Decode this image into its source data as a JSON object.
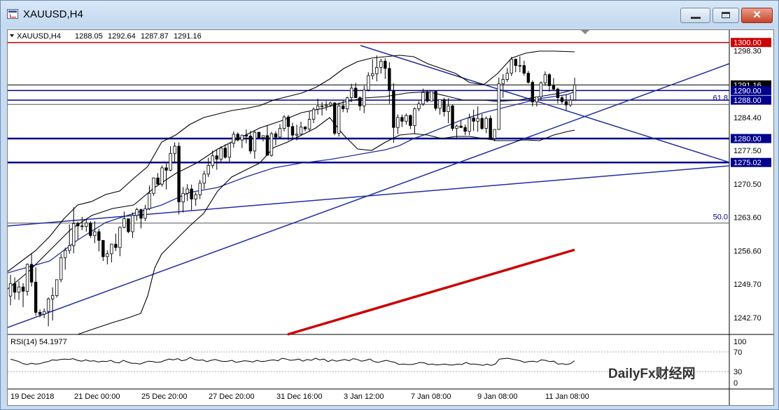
{
  "window": {
    "title": "XAUUSD,H4"
  },
  "legend": {
    "symbol": "XAUUSD,H4",
    "open": "1288.05",
    "high": "1292.64",
    "low": "1287.87",
    "close": "1291.16"
  },
  "price_axis": {
    "ticks": [
      "1298.30",
      "1284.40",
      "1277.50",
      "1270.50",
      "1263.60",
      "1256.60",
      "1249.70",
      "1242.70"
    ],
    "range": [
      1239.5,
      1302.0
    ]
  },
  "price_labels": [
    {
      "value": 1300.0,
      "text": "1300.00",
      "bg": "#cc0000"
    },
    {
      "value": 1291.16,
      "text": "1291.16",
      "bg": "#000000"
    },
    {
      "value": 1290.0,
      "text": "1290.00",
      "bg": "#00008b"
    },
    {
      "value": 1288.0,
      "text": "1288.00",
      "bg": "#00008b"
    },
    {
      "value": 1280.0,
      "text": "1280.00",
      "bg": "#00008b"
    },
    {
      "value": 1275.02,
      "text": "1275.02",
      "bg": "#00008b"
    }
  ],
  "fib_labels": [
    {
      "value": 1287.8,
      "text": "61.8"
    },
    {
      "value": 1263.0,
      "text": "50.0"
    }
  ],
  "time_axis": [
    "19 Dec 2018",
    "21 Dec 00:00",
    "25 Dec 20:00",
    "27 Dec 20:00",
    "31 Dec 16:00",
    "3 Jan 12:00",
    "7 Jan 08:00",
    "9 Jan 08:00",
    "11 Jan 08:00"
  ],
  "rsi": {
    "label": "RSI(14) 54.1977",
    "levels": [
      "100",
      "70",
      "30",
      "0"
    ],
    "values": [
      58,
      55,
      52,
      47,
      45,
      48,
      46,
      47,
      50,
      52,
      56,
      55,
      57,
      58,
      57,
      59,
      55,
      53,
      56,
      53,
      54,
      51,
      53,
      52,
      55,
      50,
      49,
      55,
      51,
      48,
      48,
      46,
      50,
      53,
      52,
      50,
      51,
      55,
      58,
      56,
      59,
      54,
      56,
      62,
      57,
      55,
      56,
      52,
      55,
      57,
      54,
      52,
      53,
      55,
      50,
      52,
      54,
      53,
      51,
      55,
      52,
      53,
      55,
      56,
      54,
      60,
      58,
      55,
      56,
      58,
      53,
      57,
      55,
      60,
      56,
      58,
      52,
      56,
      53,
      55,
      57,
      54,
      59,
      57,
      53,
      55,
      58,
      52,
      50,
      53,
      55,
      52,
      50,
      45,
      46,
      45,
      45,
      47,
      50,
      49,
      45,
      46,
      44,
      45,
      46,
      44,
      44,
      46,
      45,
      50,
      46,
      46,
      45,
      43,
      46,
      43,
      46,
      58,
      59,
      60,
      58,
      56,
      54,
      50,
      52,
      53,
      51,
      56,
      55,
      52,
      53,
      46,
      47,
      45,
      47,
      54
    ]
  },
  "colors": {
    "resistance": "#cc0000",
    "support": "#00008b",
    "trend": "#1f2fa0",
    "ma200": "#cc0000",
    "candle": "#000000"
  },
  "watermark": "DailyFx财经网",
  "candles": [
    [
      1247.2,
      1251.6,
      1245.3,
      1249.8
    ],
    [
      1249.8,
      1251.1,
      1246.5,
      1248.0
    ],
    [
      1248.0,
      1250.3,
      1246.4,
      1249.1
    ],
    [
      1249.1,
      1249.9,
      1244.9,
      1248.2
    ],
    [
      1248.2,
      1254.0,
      1247.3,
      1253.8
    ],
    [
      1253.8,
      1256.0,
      1249.2,
      1250.1
    ],
    [
      1250.1,
      1253.2,
      1243.1,
      1243.8
    ],
    [
      1243.8,
      1244.4,
      1242.8,
      1243.4
    ],
    [
      1243.4,
      1244.6,
      1242.6,
      1244.0
    ],
    [
      1244.0,
      1246.9,
      1240.9,
      1246.6
    ],
    [
      1246.6,
      1249.0,
      1242.1,
      1247.3
    ],
    [
      1247.3,
      1250.6,
      1246.9,
      1250.6
    ],
    [
      1250.6,
      1256.0,
      1250.1,
      1255.2
    ],
    [
      1255.2,
      1257.3,
      1252.7,
      1256.7
    ],
    [
      1256.7,
      1262.1,
      1256.0,
      1257.7
    ],
    [
      1257.7,
      1265.7,
      1256.1,
      1262.3
    ],
    [
      1262.3,
      1262.7,
      1259.0,
      1261.8
    ],
    [
      1261.8,
      1263.7,
      1260.9,
      1261.7
    ],
    [
      1261.7,
      1263.2,
      1260.6,
      1262.4
    ],
    [
      1262.4,
      1262.8,
      1259.3,
      1259.8
    ],
    [
      1259.8,
      1262.8,
      1258.2,
      1260.6
    ],
    [
      1260.6,
      1261.2,
      1256.5,
      1258.8
    ],
    [
      1258.8,
      1258.8,
      1254.5,
      1255.4
    ],
    [
      1255.4,
      1256.7,
      1253.8,
      1256.0
    ],
    [
      1256.0,
      1258.1,
      1254.2,
      1258.0
    ],
    [
      1258.0,
      1260.2,
      1256.6,
      1257.3
    ],
    [
      1257.3,
      1261.7,
      1255.5,
      1261.5
    ],
    [
      1261.5,
      1264.8,
      1261.3,
      1263.3
    ],
    [
      1263.3,
      1263.3,
      1260.3,
      1260.6
    ],
    [
      1260.6,
      1264.6,
      1259.3,
      1264.0
    ],
    [
      1264.0,
      1265.6,
      1262.9,
      1265.2
    ],
    [
      1265.2,
      1265.4,
      1261.3,
      1263.4
    ],
    [
      1263.4,
      1266.2,
      1262.8,
      1265.4
    ],
    [
      1265.4,
      1270.2,
      1265.1,
      1268.6
    ],
    [
      1268.6,
      1271.9,
      1268.1,
      1271.8
    ],
    [
      1271.8,
      1272.8,
      1270.4,
      1270.5
    ],
    [
      1270.5,
      1274.4,
      1270.0,
      1273.9
    ],
    [
      1273.9,
      1274.8,
      1269.4,
      1273.4
    ],
    [
      1273.4,
      1278.4,
      1273.2,
      1276.9
    ],
    [
      1276.9,
      1279.2,
      1275.1,
      1278.4
    ],
    [
      1278.4,
      1279.2,
      1264.2,
      1266.8
    ],
    [
      1266.8,
      1269.9,
      1264.6,
      1268.6
    ],
    [
      1268.6,
      1270.5,
      1267.0,
      1269.5
    ],
    [
      1269.5,
      1270.4,
      1265.1,
      1267.4
    ],
    [
      1267.4,
      1268.8,
      1266.0,
      1268.3
    ],
    [
      1268.3,
      1271.4,
      1267.4,
      1270.7
    ],
    [
      1270.7,
      1273.3,
      1269.5,
      1272.6
    ],
    [
      1272.6,
      1276.0,
      1272.0,
      1274.4
    ],
    [
      1274.4,
      1277.5,
      1273.8,
      1276.4
    ],
    [
      1276.4,
      1277.6,
      1273.5,
      1275.7
    ],
    [
      1275.7,
      1278.4,
      1275.2,
      1278.0
    ],
    [
      1278.0,
      1278.8,
      1275.8,
      1276.1
    ],
    [
      1276.1,
      1279.1,
      1274.8,
      1279.0
    ],
    [
      1279.0,
      1281.5,
      1278.1,
      1280.9
    ],
    [
      1280.9,
      1281.3,
      1279.4,
      1279.7
    ],
    [
      1279.7,
      1280.8,
      1278.0,
      1280.7
    ],
    [
      1280.7,
      1281.9,
      1279.0,
      1280.5
    ],
    [
      1280.5,
      1281.6,
      1276.8,
      1277.4
    ],
    [
      1277.4,
      1281.6,
      1275.8,
      1281.3
    ],
    [
      1281.3,
      1281.4,
      1280.2,
      1280.2
    ],
    [
      1280.2,
      1280.6,
      1279.4,
      1280.6
    ],
    [
      1280.6,
      1282.8,
      1276.5,
      1276.5
    ],
    [
      1276.5,
      1281.4,
      1276.2,
      1281.0
    ],
    [
      1281.0,
      1281.5,
      1278.6,
      1280.3
    ],
    [
      1280.3,
      1283.0,
      1279.9,
      1282.1
    ],
    [
      1282.1,
      1284.9,
      1281.5,
      1284.5
    ],
    [
      1284.5,
      1284.9,
      1279.6,
      1282.5
    ],
    [
      1282.5,
      1283.3,
      1280.0,
      1280.7
    ],
    [
      1280.7,
      1282.9,
      1279.6,
      1280.9
    ],
    [
      1280.9,
      1283.5,
      1280.7,
      1282.4
    ],
    [
      1282.4,
      1282.6,
      1281.5,
      1282.0
    ],
    [
      1282.0,
      1285.6,
      1281.4,
      1284.0
    ],
    [
      1284.0,
      1286.5,
      1283.2,
      1286.1
    ],
    [
      1286.1,
      1288.3,
      1285.0,
      1286.8
    ],
    [
      1286.8,
      1287.6,
      1284.8,
      1286.8
    ],
    [
      1286.8,
      1287.8,
      1285.8,
      1287.0
    ],
    [
      1287.0,
      1287.7,
      1286.6,
      1287.4
    ],
    [
      1287.4,
      1287.6,
      1280.7,
      1281.1
    ],
    [
      1281.1,
      1287.5,
      1280.4,
      1286.8
    ],
    [
      1286.8,
      1288.0,
      1285.5,
      1286.2
    ],
    [
      1286.2,
      1288.7,
      1285.4,
      1288.5
    ],
    [
      1288.5,
      1291.4,
      1287.6,
      1290.5
    ],
    [
      1290.5,
      1291.6,
      1288.5,
      1288.5
    ],
    [
      1288.5,
      1288.8,
      1285.8,
      1286.8
    ],
    [
      1286.8,
      1291.0,
      1285.3,
      1290.1
    ],
    [
      1290.1,
      1293.8,
      1289.8,
      1293.1
    ],
    [
      1293.1,
      1296.5,
      1292.3,
      1293.5
    ],
    [
      1293.5,
      1297.3,
      1291.9,
      1294.8
    ],
    [
      1294.8,
      1296.6,
      1293.5,
      1296.1
    ],
    [
      1296.1,
      1296.7,
      1292.4,
      1294.6
    ],
    [
      1294.6,
      1295.9,
      1287.2,
      1290.0
    ],
    [
      1290.0,
      1291.5,
      1279.1,
      1282.3
    ],
    [
      1282.3,
      1285.0,
      1280.9,
      1284.4
    ],
    [
      1284.4,
      1285.0,
      1282.4,
      1283.6
    ],
    [
      1283.6,
      1285.2,
      1282.9,
      1284.8
    ],
    [
      1284.8,
      1285.0,
      1282.0,
      1282.7
    ],
    [
      1282.7,
      1286.5,
      1280.9,
      1286.2
    ],
    [
      1286.2,
      1287.8,
      1285.7,
      1287.2
    ],
    [
      1287.2,
      1290.4,
      1286.8,
      1289.6
    ],
    [
      1289.6,
      1290.1,
      1287.5,
      1287.8
    ],
    [
      1287.8,
      1290.0,
      1287.8,
      1289.9
    ],
    [
      1289.9,
      1289.9,
      1285.8,
      1286.3
    ],
    [
      1286.3,
      1288.1,
      1285.0,
      1288.1
    ],
    [
      1288.1,
      1288.5,
      1284.6,
      1285.6
    ],
    [
      1285.6,
      1288.4,
      1283.2,
      1286.8
    ],
    [
      1286.8,
      1287.1,
      1281.6,
      1282.1
    ],
    [
      1282.1,
      1282.9,
      1279.8,
      1282.6
    ],
    [
      1282.6,
      1283.7,
      1282.2,
      1282.3
    ],
    [
      1282.3,
      1282.9,
      1280.7,
      1281.5
    ],
    [
      1281.5,
      1285.2,
      1280.7,
      1284.3
    ],
    [
      1284.3,
      1286.0,
      1281.6,
      1283.6
    ],
    [
      1283.6,
      1286.7,
      1281.4,
      1284.2
    ],
    [
      1284.2,
      1285.1,
      1281.8,
      1282.1
    ],
    [
      1282.1,
      1284.6,
      1281.1,
      1284.2
    ],
    [
      1284.2,
      1284.8,
      1280.0,
      1280.0
    ],
    [
      1280.0,
      1281.9,
      1279.4,
      1281.9
    ],
    [
      1281.9,
      1292.7,
      1281.8,
      1291.4
    ],
    [
      1291.4,
      1293.4,
      1288.5,
      1292.3
    ],
    [
      1292.3,
      1294.7,
      1291.8,
      1293.6
    ],
    [
      1293.6,
      1297.0,
      1293.0,
      1296.5
    ],
    [
      1296.5,
      1296.7,
      1293.8,
      1295.2
    ],
    [
      1295.2,
      1297.1,
      1293.8,
      1295.2
    ],
    [
      1295.2,
      1296.2,
      1293.1,
      1293.6
    ],
    [
      1293.6,
      1294.1,
      1291.4,
      1291.7
    ],
    [
      1291.7,
      1292.1,
      1286.7,
      1287.6
    ],
    [
      1287.6,
      1288.7,
      1286.7,
      1288.7
    ],
    [
      1288.7,
      1291.9,
      1288.0,
      1291.6
    ],
    [
      1291.6,
      1294.0,
      1291.0,
      1293.3
    ],
    [
      1293.3,
      1293.6,
      1289.8,
      1291.0
    ],
    [
      1291.0,
      1292.6,
      1290.0,
      1290.3
    ],
    [
      1290.3,
      1290.6,
      1287.3,
      1288.5
    ],
    [
      1288.5,
      1289.0,
      1287.2,
      1287.7
    ],
    [
      1287.7,
      1289.2,
      1285.9,
      1287.0
    ],
    [
      1287.0,
      1289.1,
      1286.6,
      1288.0
    ],
    [
      1288.05,
      1292.64,
      1287.87,
      1291.16
    ]
  ]
}
